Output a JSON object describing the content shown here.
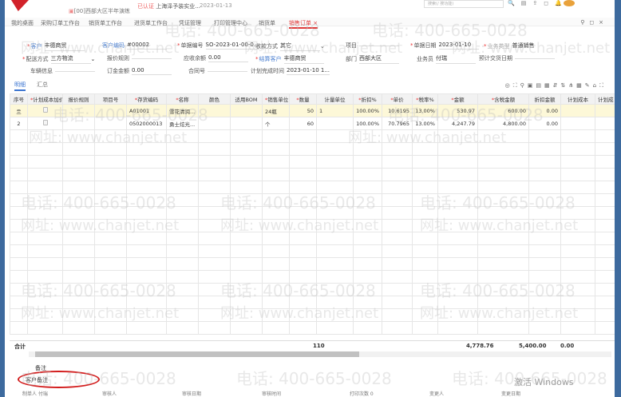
{
  "header": {
    "org": "[00]西部大区半年演练",
    "certified": "已认证",
    "company": "上海泽予装实业...",
    "date": "2023-01-13",
    "search_placeholder": "搜索(/ 搜功能)"
  },
  "tabs": [
    {
      "label": "我的桌面"
    },
    {
      "label": "采购订单工作台"
    },
    {
      "label": "销货单工作台"
    },
    {
      "label": "进货单工作台"
    },
    {
      "label": "凭证管理"
    },
    {
      "label": "打印管理中心"
    },
    {
      "label": "销货单"
    },
    {
      "label": "销售订单",
      "active": true
    }
  ],
  "form": {
    "customer": {
      "label": "客户",
      "value": "丰德商贸"
    },
    "customer_code": {
      "label": "客户编码",
      "value": "#00002"
    },
    "doc_no": {
      "label": "单据编号",
      "value": "SO-2023-01-00-0..."
    },
    "payment": {
      "label": "收款方式",
      "value": "其它"
    },
    "project": {
      "label": "项目",
      "value": ""
    },
    "doc_date": {
      "label": "单据日期",
      "value": "2023-01-10"
    },
    "biz_type": {
      "label": "业务类型",
      "value": "普通销售"
    },
    "delivery": {
      "label": "配送方式",
      "value": "三方物流"
    },
    "quote_rule": {
      "label": "报价规则",
      "value": ""
    },
    "receivable": {
      "label": "应收余额",
      "value": "0.00"
    },
    "settle_customer": {
      "label": "结算客户",
      "value": "丰德商贸"
    },
    "dept": {
      "label": "部门",
      "value": "西部大区"
    },
    "salesman": {
      "label": "业务员",
      "value": "付瑞"
    },
    "exp_delivery": {
      "label": "预计交货日期",
      "value": ""
    },
    "vehicle": {
      "label": "车辆信息",
      "value": ""
    },
    "deposit": {
      "label": "订金金额",
      "value": "0.00"
    },
    "contract": {
      "label": "合同号",
      "value": ""
    },
    "plan_finish": {
      "label": "计划完成时间",
      "value": "2023-01-10 1..."
    }
  },
  "subtabs": {
    "detail": "明细",
    "summary": "汇总"
  },
  "columns": [
    "序号",
    "计划成本加价",
    "报价规则",
    "项目号",
    "存货编码",
    "名称",
    "颜色",
    "适用BOM",
    "销售单位",
    "数量",
    "计量单位",
    "折扣%",
    "单价",
    "税率%",
    "金额",
    "含税金额",
    "折扣金额",
    "计划成本",
    "计划成"
  ],
  "rows": [
    {
      "no": "亖",
      "code": "A01001",
      "name": "雪花清润...",
      "unit": "24瓶",
      "qty": "50",
      "mu": "1",
      "disc": "100.00%",
      "price": "10.6195",
      "tax": "13.00%",
      "amount": "530.97",
      "tax_amount": "600.00",
      "disc_amount": "0.00"
    },
    {
      "no": "2",
      "code": "0502000013",
      "name": "勇士炫光...",
      "unit": "个",
      "qty": "60",
      "mu": "",
      "disc": "100.00%",
      "price": "70.7965",
      "tax": "13.00%",
      "amount": "4,247.79",
      "tax_amount": "4,800.00",
      "disc_amount": "0.00"
    }
  ],
  "totals": {
    "label": "合计",
    "qty": "110",
    "amount": "4,778.76",
    "tax_amount": "5,400.00",
    "disc_amount": "0.00"
  },
  "memo": {
    "label": "备注",
    "customer_memo": "客户备注"
  },
  "footer": {
    "maker": "制单人 付瑞",
    "auditor": "审核人",
    "audit_date": "审核日期",
    "audit_time": "审核时间",
    "print": "打印次数 0",
    "submitter": "变更人",
    "change_date": "变更日期"
  },
  "watermark": {
    "phone": "电话: 400-665-0028",
    "url": "网址: www.chanjet.net"
  },
  "activate": "激活 Windows"
}
